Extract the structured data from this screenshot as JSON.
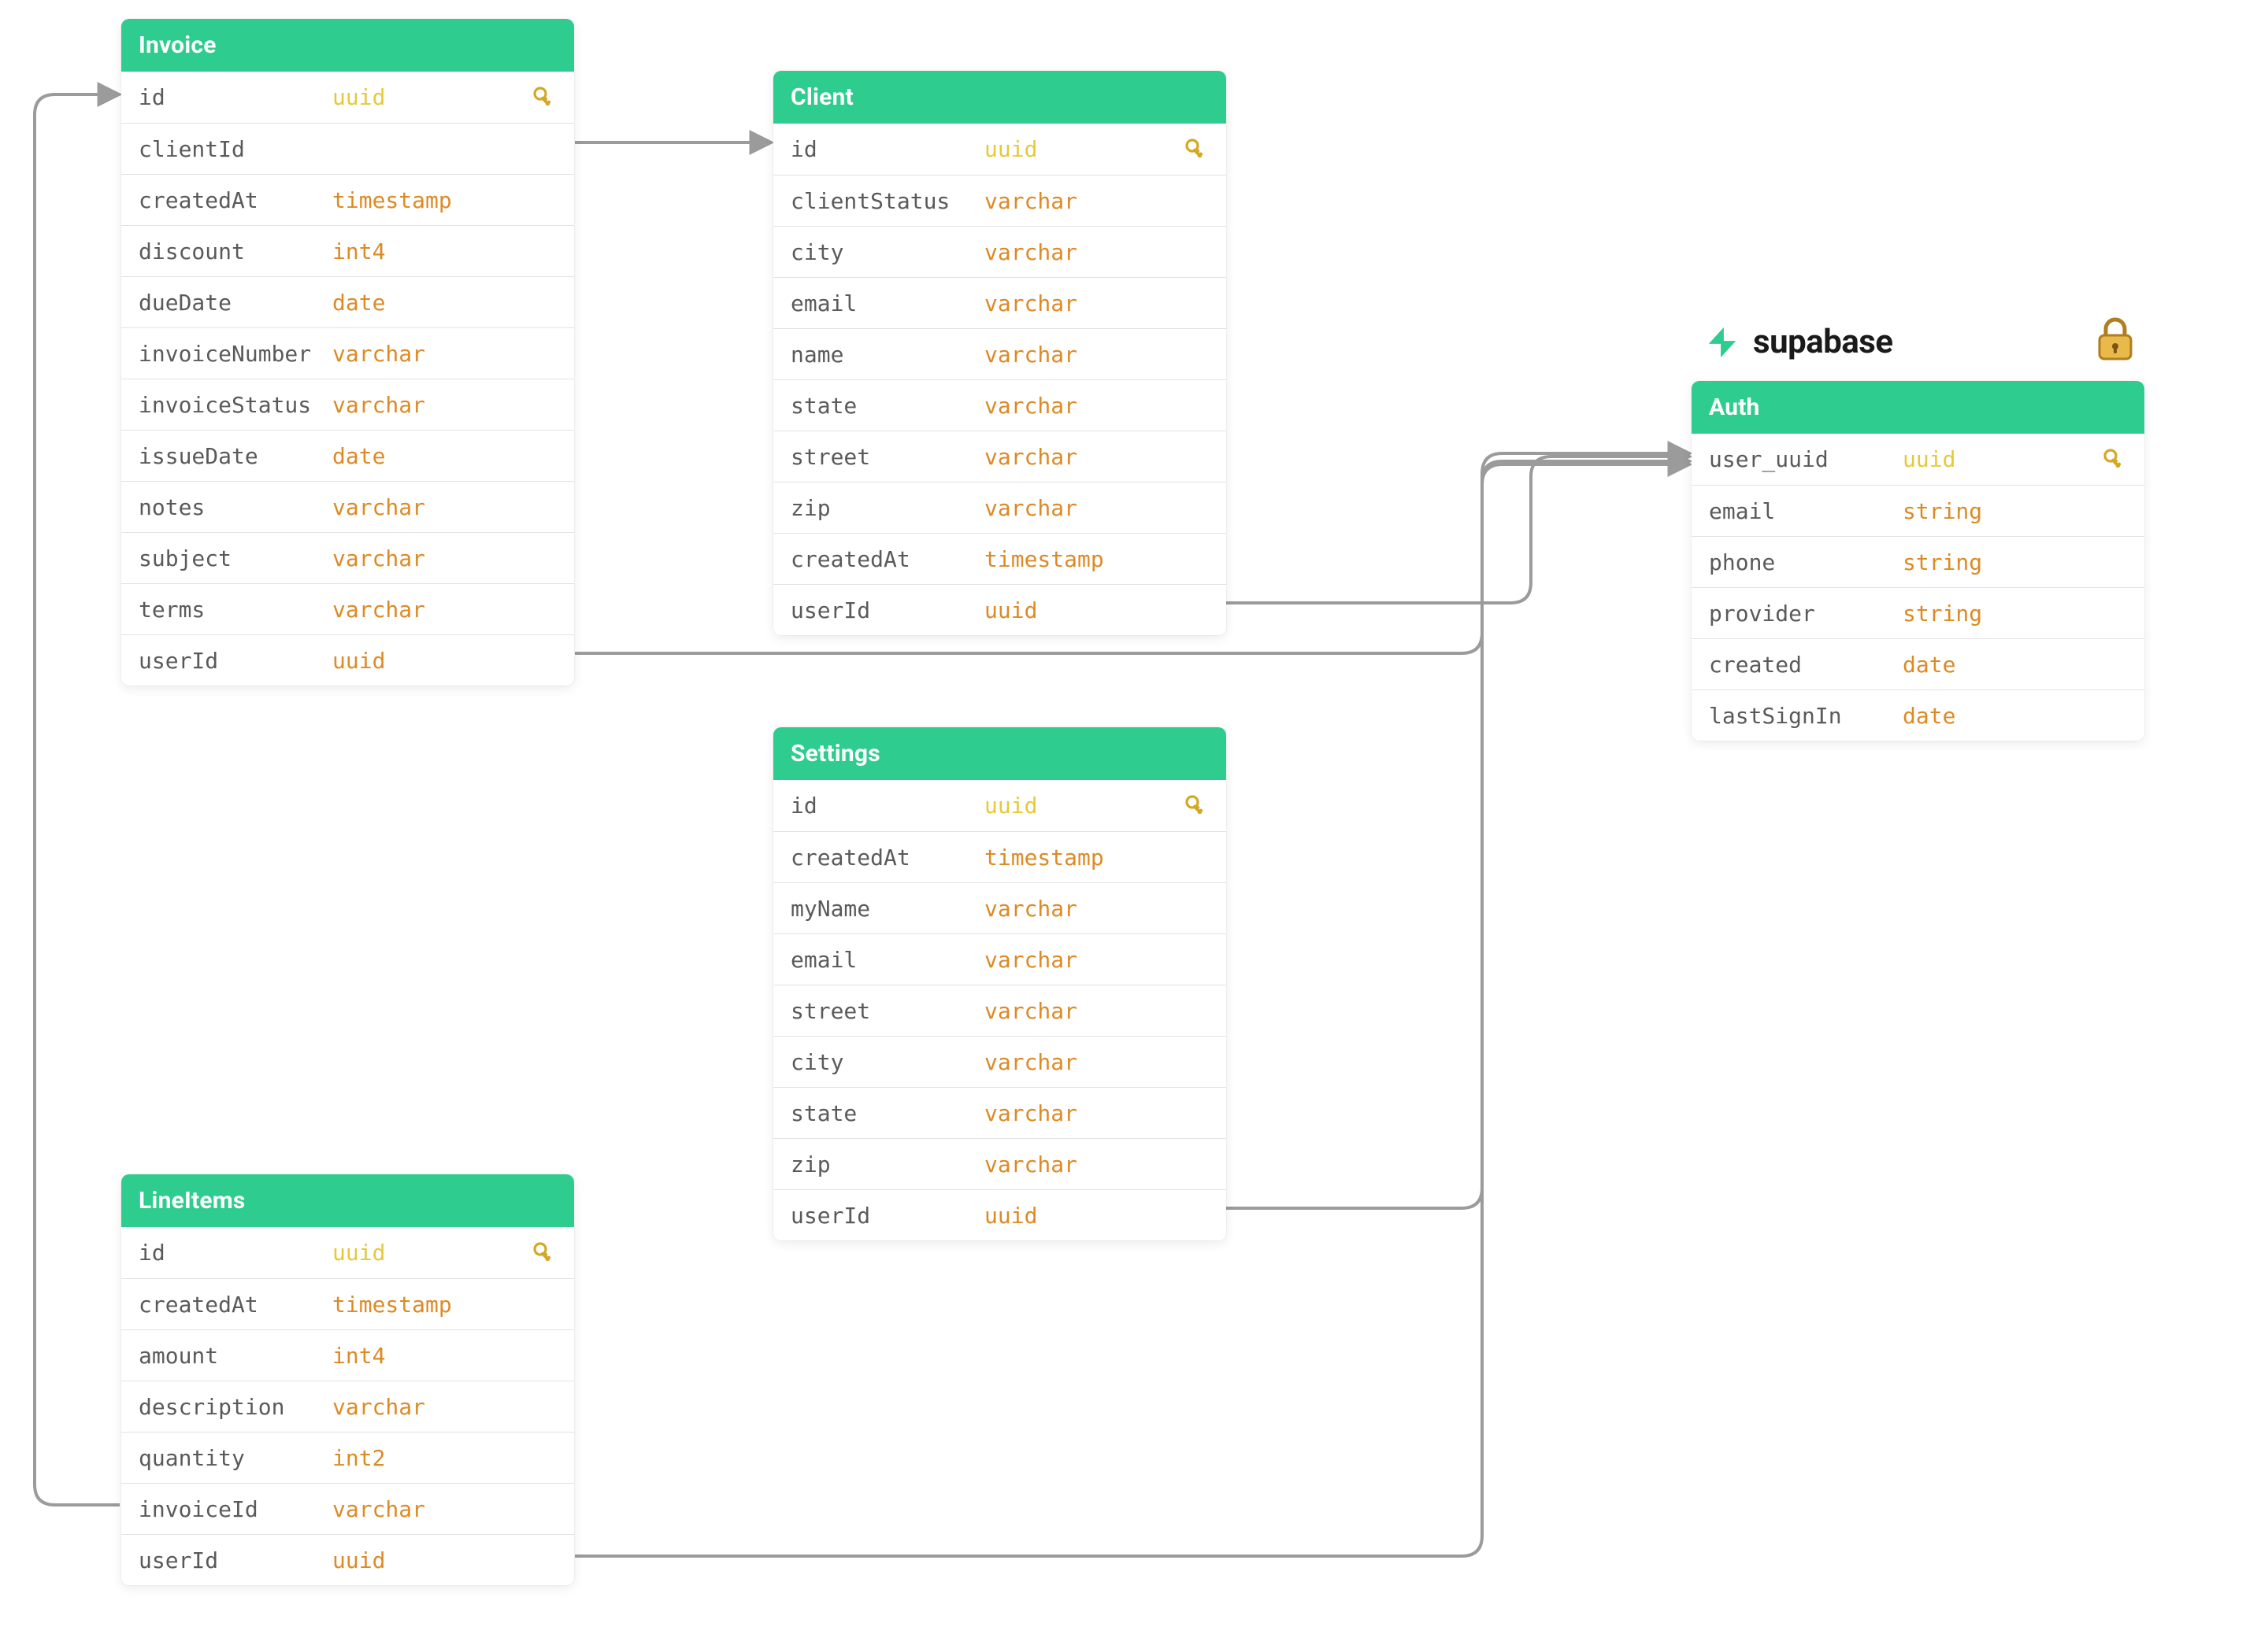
{
  "colors": {
    "header_bg": "#2ecc8f",
    "type_text": "#dd8a25",
    "pk_type_text": "#e5c93a",
    "border": "#e2e2e2",
    "column_text": "#5a5a5a"
  },
  "brand": {
    "name": "supabase"
  },
  "tables": {
    "invoice": {
      "title": "Invoice",
      "columns": [
        {
          "name": "id",
          "type": "uuid",
          "pk": true
        },
        {
          "name": "clientId",
          "type": "",
          "pk": false
        },
        {
          "name": "createdAt",
          "type": "timestamp",
          "pk": false
        },
        {
          "name": "discount",
          "type": "int4",
          "pk": false
        },
        {
          "name": "dueDate",
          "type": "date",
          "pk": false
        },
        {
          "name": "invoiceNumber",
          "type": "varchar",
          "pk": false
        },
        {
          "name": "invoiceStatus",
          "type": "varchar",
          "pk": false
        },
        {
          "name": "issueDate",
          "type": "date",
          "pk": false
        },
        {
          "name": "notes",
          "type": "varchar",
          "pk": false
        },
        {
          "name": "subject",
          "type": "varchar",
          "pk": false
        },
        {
          "name": "terms",
          "type": "varchar",
          "pk": false
        },
        {
          "name": "userId",
          "type": "uuid",
          "pk": false
        }
      ]
    },
    "client": {
      "title": "Client",
      "columns": [
        {
          "name": "id",
          "type": "uuid",
          "pk": true
        },
        {
          "name": "clientStatus",
          "type": "varchar",
          "pk": false
        },
        {
          "name": "city",
          "type": "varchar",
          "pk": false
        },
        {
          "name": "email",
          "type": "varchar",
          "pk": false
        },
        {
          "name": "name",
          "type": "varchar",
          "pk": false
        },
        {
          "name": "state",
          "type": "varchar",
          "pk": false
        },
        {
          "name": "street",
          "type": "varchar",
          "pk": false
        },
        {
          "name": "zip",
          "type": "varchar",
          "pk": false
        },
        {
          "name": "createdAt",
          "type": "timestamp",
          "pk": false
        },
        {
          "name": "userId",
          "type": "uuid",
          "pk": false
        }
      ]
    },
    "settings": {
      "title": "Settings",
      "columns": [
        {
          "name": "id",
          "type": "uuid",
          "pk": true
        },
        {
          "name": "createdAt",
          "type": "timestamp",
          "pk": false
        },
        {
          "name": "myName",
          "type": "varchar",
          "pk": false
        },
        {
          "name": "email",
          "type": "varchar",
          "pk": false
        },
        {
          "name": "street",
          "type": "varchar",
          "pk": false
        },
        {
          "name": "city",
          "type": "varchar",
          "pk": false
        },
        {
          "name": "state",
          "type": "varchar",
          "pk": false
        },
        {
          "name": "zip",
          "type": "varchar",
          "pk": false
        },
        {
          "name": "userId",
          "type": "uuid",
          "pk": false
        }
      ]
    },
    "lineitems": {
      "title": "LineItems",
      "columns": [
        {
          "name": "id",
          "type": "uuid",
          "pk": true
        },
        {
          "name": "createdAt",
          "type": "timestamp",
          "pk": false
        },
        {
          "name": "amount",
          "type": "int4",
          "pk": false
        },
        {
          "name": "description",
          "type": "varchar",
          "pk": false
        },
        {
          "name": "quantity",
          "type": "int2",
          "pk": false
        },
        {
          "name": "invoiceId",
          "type": "varchar",
          "pk": false
        },
        {
          "name": "userId",
          "type": "uuid",
          "pk": false
        }
      ]
    },
    "auth": {
      "title": "Auth",
      "columns": [
        {
          "name": "user_uuid",
          "type": "uuid",
          "pk": true
        },
        {
          "name": "email",
          "type": "string",
          "pk": false
        },
        {
          "name": "phone",
          "type": "string",
          "pk": false
        },
        {
          "name": "provider",
          "type": "string",
          "pk": false
        },
        {
          "name": "created",
          "type": "date",
          "pk": false
        },
        {
          "name": "lastSignIn",
          "type": "date",
          "pk": false
        }
      ]
    }
  },
  "relations": [
    {
      "from": "invoice.clientId",
      "to": "client.id"
    },
    {
      "from": "invoice.userId",
      "to": "auth.user_uuid"
    },
    {
      "from": "client.userId",
      "to": "auth.user_uuid"
    },
    {
      "from": "settings.userId",
      "to": "auth.user_uuid"
    },
    {
      "from": "lineitems.invoiceId",
      "to": "invoice.id"
    },
    {
      "from": "lineitems.userId",
      "to": "auth.user_uuid"
    }
  ]
}
